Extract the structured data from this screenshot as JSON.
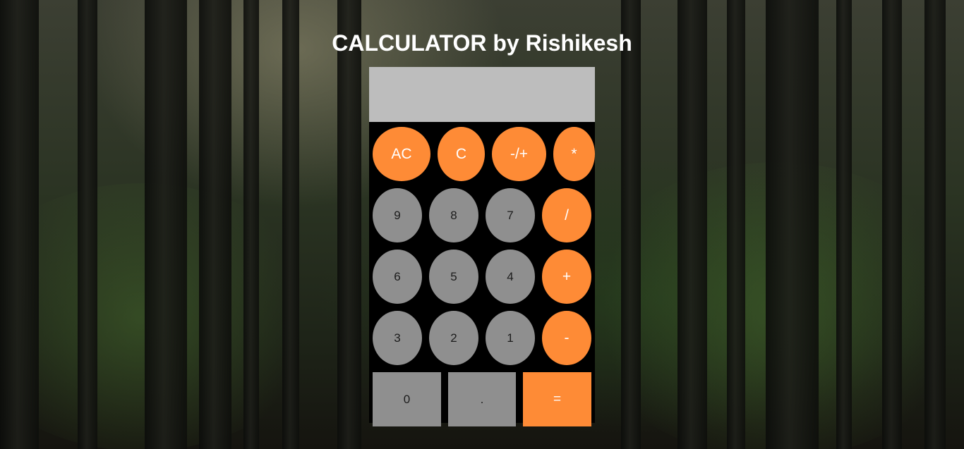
{
  "title": "CALCULATOR by Rishikesh",
  "display": {
    "value": ""
  },
  "colors": {
    "accent": "#fe8b36",
    "digit_key": "#8f8f8f",
    "display_bg": "#bdbdbd",
    "body": "#000000"
  },
  "keys": {
    "ac": "AC",
    "c": "C",
    "negate": "-/+",
    "multiply": "*",
    "nine": "9",
    "eight": "8",
    "seven": "7",
    "divide": "/",
    "six": "6",
    "five": "5",
    "four": "4",
    "add": "+",
    "three": "3",
    "two": "2",
    "one": "1",
    "subtract": "-",
    "zero": "0",
    "decimal": ".",
    "equals": "="
  }
}
